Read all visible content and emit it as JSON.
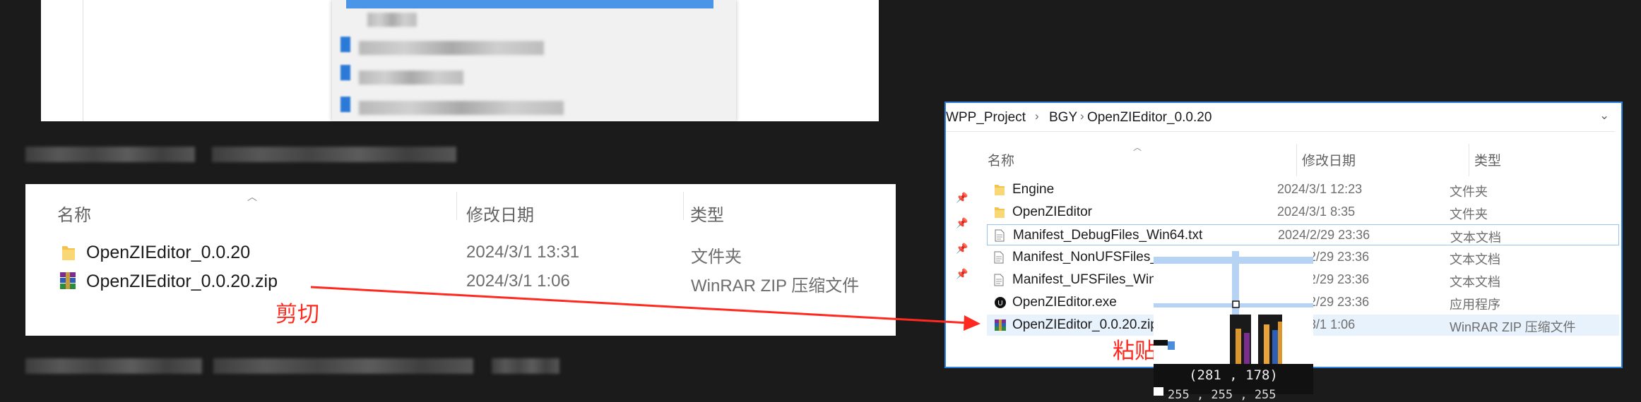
{
  "left_explorer": {
    "columns": {
      "name": "名称",
      "modified": "修改日期",
      "type": "类型"
    },
    "rows": [
      {
        "name": "OpenZIEditor_0.0.20",
        "modified": "2024/3/1 13:31",
        "type": "文件夹",
        "icon": "folder-icon"
      },
      {
        "name": "OpenZIEditor_0.0.20.zip",
        "modified": "2024/3/1 1:06",
        "type": "WinRAR ZIP 压缩文件",
        "icon": "winrar-zip-icon"
      }
    ]
  },
  "annotations": {
    "cut_label": "剪切",
    "paste_label": "粘贴",
    "arrow_color": "#ff2a1f"
  },
  "right_explorer": {
    "breadcrumb": [
      "WPP_Project",
      "BGY",
      "OpenZIEditor_0.0.20"
    ],
    "columns": {
      "name": "名称",
      "modified": "修改日期",
      "type": "类型"
    },
    "rows": [
      {
        "name": "Engine",
        "modified": "2024/3/1 12:23",
        "type": "文件夹",
        "icon": "folder-icon"
      },
      {
        "name": "OpenZIEditor",
        "modified": "2024/3/1 8:35",
        "type": "文件夹",
        "icon": "folder-icon"
      },
      {
        "name": "Manifest_DebugFiles_Win64.txt",
        "modified": "2024/2/29 23:36",
        "type": "文本文档",
        "icon": "text-file-icon"
      },
      {
        "name": "Manifest_NonUFSFiles_",
        "modified": "2024/2/29 23:36",
        "type": "文本文档",
        "icon": "text-file-icon"
      },
      {
        "name": "Manifest_UFSFiles_Win6",
        "modified": "2024/2/29 23:36",
        "type": "文本文档",
        "icon": "text-file-icon"
      },
      {
        "name": "OpenZIEditor.exe",
        "modified": "2024/2/29 23:36",
        "type": "应用程序",
        "icon": "unreal-engine-icon"
      },
      {
        "name": "OpenZIEditor_0.0.20.zip",
        "modified": "2024/3/1 1:06",
        "type": "WinRAR ZIP 压缩文件",
        "icon": "winrar-zip-icon"
      }
    ]
  },
  "magnifier": {
    "coords": "(281 , 178)",
    "rgb": "255 , 255 , 255"
  },
  "colors": {
    "accent": "#2d7fd9",
    "selection": "#e8f2fd",
    "annotation_red": "#ff2a1f"
  }
}
